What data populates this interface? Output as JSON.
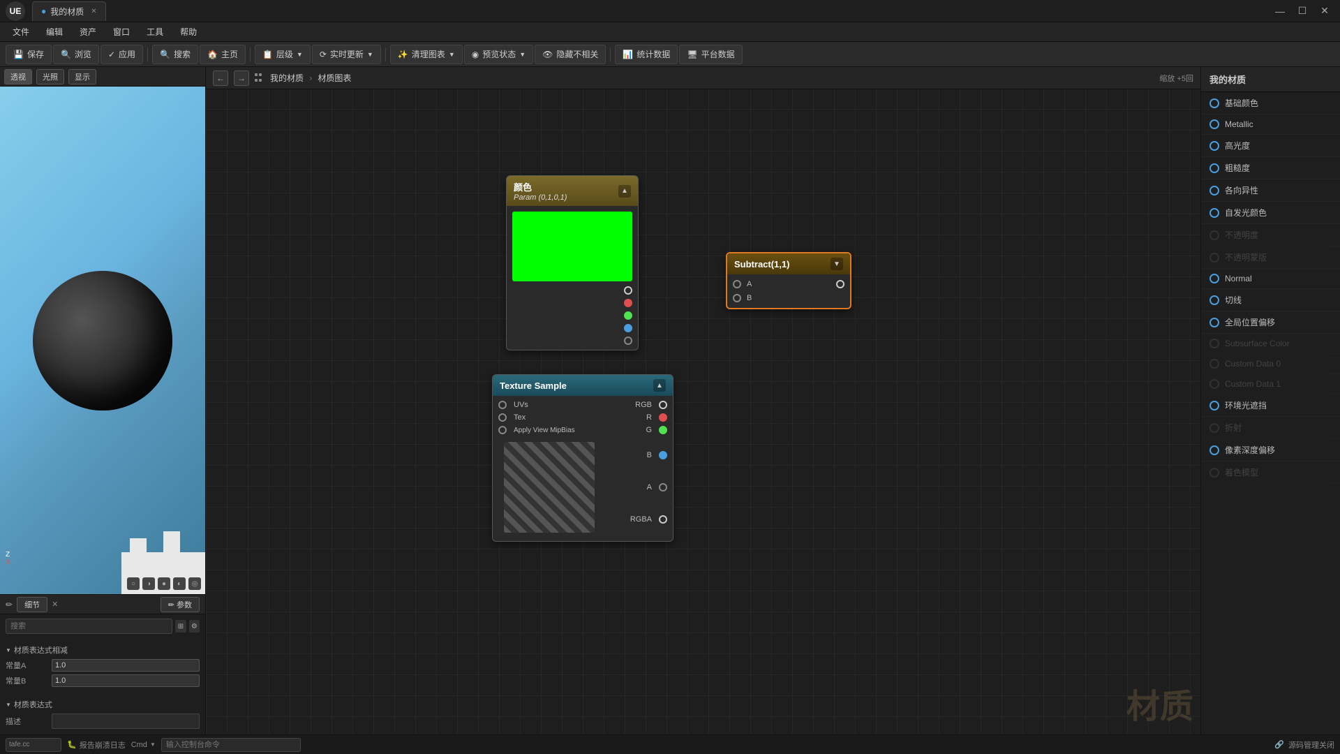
{
  "titleBar": {
    "logo": "UE",
    "tabs": [
      {
        "label": "我的材质",
        "active": true
      }
    ],
    "controls": {
      "minimize": "—",
      "maximize": "☐",
      "close": "✕"
    }
  },
  "menuBar": {
    "items": [
      "文件",
      "编辑",
      "资产",
      "窗口",
      "工具",
      "帮助"
    ]
  },
  "toolbar": {
    "buttons": [
      {
        "id": "save",
        "icon": "💾",
        "label": "保存"
      },
      {
        "id": "browse",
        "icon": "🔍",
        "label": "浏览"
      },
      {
        "id": "apply",
        "icon": "✓",
        "label": "应用"
      },
      {
        "id": "search",
        "icon": "🔍",
        "label": "搜索"
      },
      {
        "id": "home",
        "icon": "🏠",
        "label": "主页"
      },
      {
        "id": "layer",
        "icon": "📋",
        "label": "层级"
      },
      {
        "id": "realtime",
        "icon": "⟳",
        "label": "实时更新"
      },
      {
        "id": "clean",
        "icon": "✨",
        "label": "清理图表"
      },
      {
        "id": "previewstate",
        "icon": "◉",
        "label": "预览状态"
      },
      {
        "id": "hideirrelevant",
        "icon": "👁",
        "label": "隐藏不相关"
      },
      {
        "id": "stats",
        "icon": "📊",
        "label": "统计数据"
      },
      {
        "id": "platform",
        "icon": "🖥",
        "label": "平台数据"
      }
    ]
  },
  "breadcrumb": {
    "back": "←",
    "forward": "→",
    "items": [
      "我的材质",
      "材质图表"
    ],
    "separator": ">"
  },
  "viewportControls": {
    "perspective": "透视",
    "lighting": "光照",
    "display": "显示",
    "zoomLevel": "缩放 +5回"
  },
  "detailsPanel": {
    "title": "细节",
    "close": "✕",
    "paramTab": "参数",
    "searchPlaceholder": "搜索",
    "sections": {
      "materialExpressionRelative": "材质表达式相减",
      "constA": {
        "label": "常量A",
        "value": "1.0"
      },
      "constB": {
        "label": "常量B",
        "value": "1.0"
      },
      "materialExpression": "材质表达式",
      "description": {
        "label": "描述",
        "value": ""
      }
    }
  },
  "colorNode": {
    "title": "颜色",
    "subtitle": "Param (0,1,0,1)",
    "collapseIcon": "▲",
    "colorPreview": "#00ff00",
    "pins": {
      "output_white": "white",
      "output_red": "red",
      "output_green": "green",
      "output_blue": "blue",
      "output_gray": "gray"
    }
  },
  "subtractNode": {
    "title": "Subtract(1,1)",
    "collapseIcon": "▼",
    "inputs": [
      "A",
      "B"
    ],
    "outputPin": "white"
  },
  "textureSampleNode": {
    "title": "Texture Sample",
    "collapseIcon": "▲",
    "inputs": [
      {
        "label": "UVs",
        "pinColor": "gray"
      },
      {
        "label": "Tex",
        "pinColor": "gray"
      },
      {
        "label": "Apply View MipBias",
        "pinColor": "gray"
      }
    ],
    "outputs": [
      {
        "label": "RGB",
        "pinColor": "white"
      },
      {
        "label": "R",
        "pinColor": "red"
      },
      {
        "label": "G",
        "pinColor": "green"
      },
      {
        "label": "B",
        "pinColor": "blue"
      },
      {
        "label": "A",
        "pinColor": "gray"
      },
      {
        "label": "RGBA",
        "pinColor": "white"
      }
    ]
  },
  "rightPanel": {
    "title": "我的材质",
    "properties": [
      {
        "id": "base-color",
        "label": "基础颜色",
        "active": true,
        "disabled": false
      },
      {
        "id": "metallic",
        "label": "Metallic",
        "active": true,
        "disabled": false
      },
      {
        "id": "highlight",
        "label": "高光度",
        "active": true,
        "disabled": false
      },
      {
        "id": "roughness",
        "label": "粗糙度",
        "active": true,
        "disabled": false
      },
      {
        "id": "anisotropy",
        "label": "各向异性",
        "active": true,
        "disabled": false
      },
      {
        "id": "emissive",
        "label": "自发光颜色",
        "active": true,
        "disabled": false
      },
      {
        "id": "opacity",
        "label": "不透明度",
        "active": false,
        "disabled": true
      },
      {
        "id": "opacity-mask",
        "label": "不透明蒙版",
        "active": false,
        "disabled": true
      },
      {
        "id": "normal",
        "label": "Normal",
        "active": true,
        "disabled": false
      },
      {
        "id": "tangent",
        "label": "切线",
        "active": true,
        "disabled": false
      },
      {
        "id": "world-offset",
        "label": "全局位置偏移",
        "active": true,
        "disabled": false
      },
      {
        "id": "subsurface-color",
        "label": "Subsurface Color",
        "active": false,
        "disabled": true
      },
      {
        "id": "custom-data-0",
        "label": "Custom Data 0",
        "active": false,
        "disabled": true
      },
      {
        "id": "custom-data-1",
        "label": "Custom Data 1",
        "active": false,
        "disabled": true
      },
      {
        "id": "ao",
        "label": "环境光遮挡",
        "active": true,
        "disabled": false
      },
      {
        "id": "refraction",
        "label": "折射",
        "active": false,
        "disabled": true
      },
      {
        "id": "pixel-depth-offset",
        "label": "像素深度偏移",
        "active": true,
        "disabled": false
      },
      {
        "id": "shading-model",
        "label": "着色模型",
        "active": false,
        "disabled": true
      }
    ]
  },
  "statusBar": {
    "bug": "报告崩溃日志",
    "cmd": "Cmd",
    "input": "输入控制台命令",
    "sourceControl": "源码管理关闭"
  },
  "watermark": "材质"
}
